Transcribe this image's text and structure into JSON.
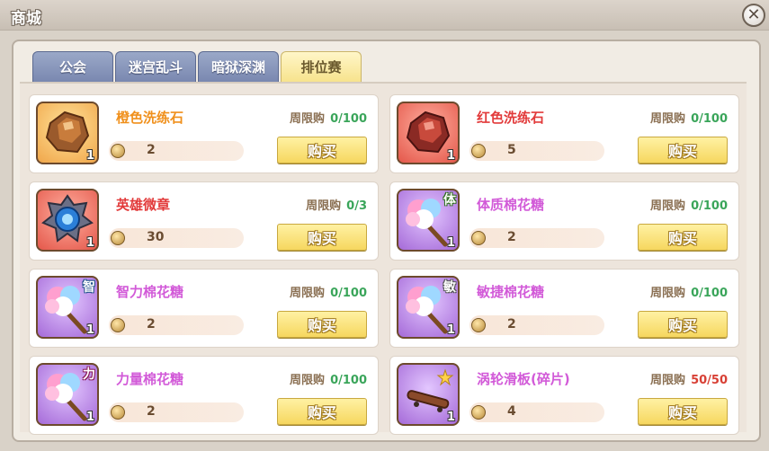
{
  "window": {
    "title": "商城",
    "close_symbol": "✕"
  },
  "tabs": [
    {
      "label": "公会",
      "active": false
    },
    {
      "label": "迷宫乱斗",
      "active": false
    },
    {
      "label": "暗狱深渊",
      "active": false
    },
    {
      "label": "排位赛",
      "active": true
    }
  ],
  "colors": {
    "name_orange": "#f0901c",
    "name_red": "#e23a3a",
    "name_purple": "#d25ad8",
    "limit_ok": "#3aa55a",
    "limit_full": "#d84035"
  },
  "items": [
    {
      "name": "橙色洗练石",
      "limit_label": "周限购",
      "limit_value": "0/100",
      "price": "2",
      "count": "1",
      "buy_label": "购买",
      "icon": "orange-gem-icon",
      "tag": ""
    },
    {
      "name": "红色洗练石",
      "limit_label": "周限购",
      "limit_value": "0/100",
      "price": "5",
      "count": "1",
      "buy_label": "购买",
      "icon": "red-gem-icon",
      "tag": ""
    },
    {
      "name": "英雄微章",
      "limit_label": "周限购",
      "limit_value": "0/3",
      "price": "30",
      "count": "1",
      "buy_label": "购买",
      "icon": "hero-badge-icon",
      "tag": ""
    },
    {
      "name": "体质棉花糖",
      "limit_label": "周限购",
      "limit_value": "0/100",
      "price": "2",
      "count": "1",
      "buy_label": "购买",
      "icon": "cotton-candy-icon",
      "tag": "体"
    },
    {
      "name": "智力棉花糖",
      "limit_label": "周限购",
      "limit_value": "0/100",
      "price": "2",
      "count": "1",
      "buy_label": "购买",
      "icon": "cotton-candy-icon",
      "tag": "智"
    },
    {
      "name": "敏捷棉花糖",
      "limit_label": "周限购",
      "limit_value": "0/100",
      "price": "2",
      "count": "1",
      "buy_label": "购买",
      "icon": "cotton-candy-icon",
      "tag": "敏"
    },
    {
      "name": "力量棉花糖",
      "limit_label": "周限购",
      "limit_value": "0/100",
      "price": "2",
      "count": "1",
      "buy_label": "购买",
      "icon": "cotton-candy-icon",
      "tag": "力"
    },
    {
      "name": "涡轮滑板(碎片)",
      "limit_label": "周限购",
      "limit_value": "50/50",
      "price": "4",
      "count": "1",
      "buy_label": "购买",
      "icon": "skateboard-fragment-icon",
      "tag": ""
    }
  ]
}
